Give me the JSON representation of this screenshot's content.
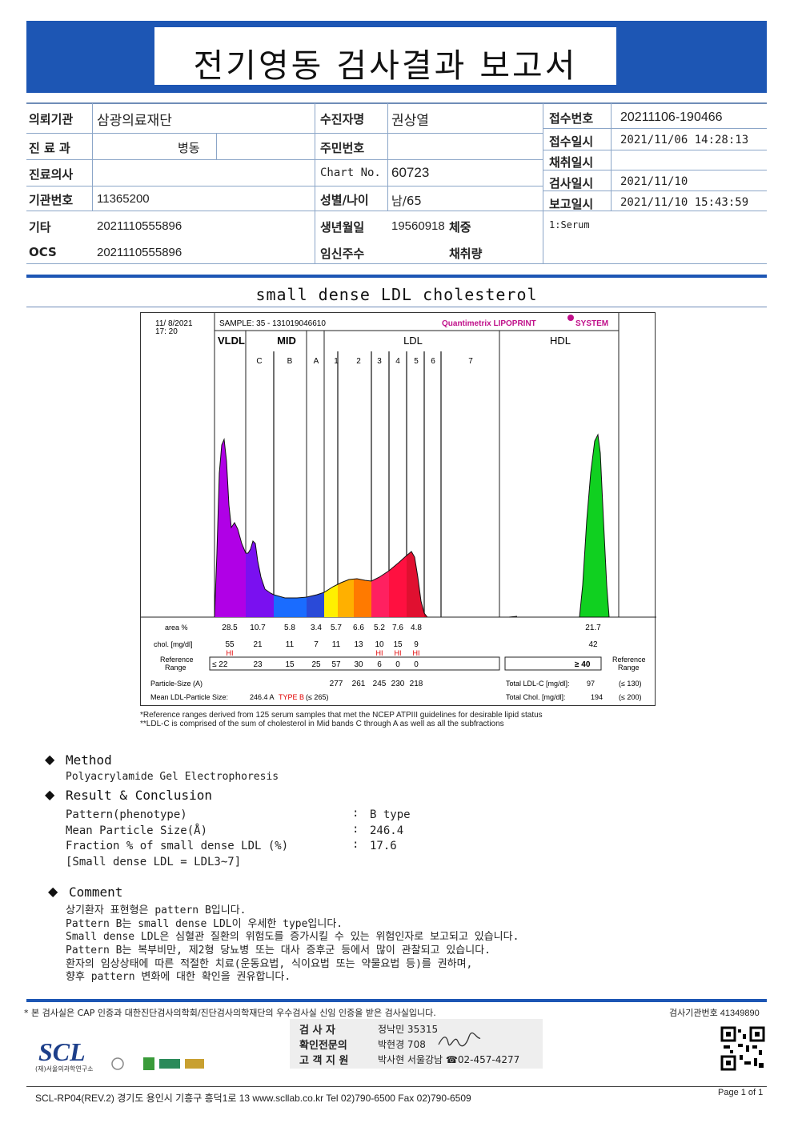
{
  "title": "전기영동 검사결과 보고서",
  "info": {
    "requester_label": "의뢰기관",
    "requester": "삼광의료재단",
    "dept_label": "진 료 과",
    "ward_label": "병동",
    "doctor_label": "진료의사",
    "inst_label": "기관번호",
    "inst": "11365200",
    "etc_label": "기타",
    "etc": "2021110555896",
    "ocs_label": "OCS",
    "ocs": "2021110555896",
    "patient_label": "수진자명",
    "patient": "권상열",
    "rrn_label": "주민번호",
    "chart_label": "Chart No.",
    "chart": "60723",
    "sexage_label": "성별/나이",
    "sexage": "남/65",
    "dob_label": "생년월일",
    "dob": "19560918",
    "weight_label": "체중",
    "preg_label": "임신주수",
    "amount_label": "채취량",
    "recv_no_label": "접수번호",
    "recv_no": "20211106-190466",
    "recv_dt_label": "접수일시",
    "recv_dt": "2021/11/06 14:28:13",
    "collect_label": "채취일시",
    "test_label": "검사일시",
    "test_dt": "2021/11/10",
    "report_label": "보고일시",
    "report_dt": "2021/11/10 15:43:59",
    "specimen": "1:Serum"
  },
  "section_title": "small dense LDL cholesterol",
  "chart_data": {
    "type": "area",
    "header_date": "11/ 8/2021",
    "header_time": "17: 20",
    "sample": "SAMPLE:   35 - 131019046610",
    "brand": "Quantimetrix  LIPOPRINT",
    "brand_system": "SYSTEM",
    "groups": [
      "VLDL",
      "MID",
      "LDL",
      "HDL"
    ],
    "bands": [
      "C",
      "B",
      "A",
      "1",
      "2",
      "3",
      "4",
      "5",
      "6",
      "7"
    ],
    "row_labels": {
      "area": "area %",
      "chol": "chol. [mg/dl]",
      "ref": "Reference Range",
      "ref_right": "Reference Range",
      "particle": "Particle-Size (A)",
      "mean": "Mean LDL-Particle Size:"
    },
    "area": [
      "28.5",
      "10.7",
      "5.8",
      "3.4",
      "5.7",
      "6.6",
      "5.2",
      "7.6",
      "4.8",
      "21.7"
    ],
    "chol": [
      "55",
      "21",
      "11",
      "7",
      "11",
      "13",
      "10",
      "15",
      "9",
      "42"
    ],
    "hi": {
      "vldl": "HI",
      "ldl3": "HI",
      "ldl4": "HI",
      "ldl5": "HI"
    },
    "ref_le": "≤ 22",
    "ref": [
      "23",
      "15",
      "25",
      "57",
      "30",
      "6",
      "0",
      "0"
    ],
    "ref_hdl": "≥  40",
    "particle": [
      "277",
      "261",
      "245",
      "230",
      "218"
    ],
    "mean_size": "246.4  A",
    "mean_type": "TYPE B",
    "mean_ref": "(≤ 265)",
    "total_ldl_label": "Total LDL-C  [mg/dl]:",
    "total_ldl": "97",
    "total_ldl_ref": "(≤ 130)",
    "total_chol_label": "Total Chol.  [mg/dl]:",
    "total_chol": "194",
    "total_chol_ref": "(≤ 200)"
  },
  "notes": [
    "*Reference ranges derived from 125 serum samples that met the NCEP ATPIII guidelines for desirable lipid status",
    "**LDL-C is comprised of the sum of cholesterol in Mid bands C through A as well as all the subfractions"
  ],
  "method": {
    "heading": "Method",
    "text": "Polyacrylamide Gel Electrophoresis"
  },
  "result": {
    "heading": "Result & Conclusion",
    "rows": [
      {
        "label": "Pattern(phenotype)",
        "value": "B type"
      },
      {
        "label": "Mean Particle Size(Å)",
        "value": "246.4"
      },
      {
        "label": "Fraction % of small dense LDL (%)",
        "value": "17.6"
      }
    ],
    "bracket": "[Small dense LDL = LDL3~7]"
  },
  "comment": {
    "heading": "Comment",
    "lines": [
      "상기환자 표현형은 pattern B입니다.",
      "Pattern B는 small dense LDL이 우세한 type입니다.",
      "Small dense LDL은 심혈관 질환의 위험도를 증가시킬 수 있는 위험인자로 보고되고 있습니다.",
      "Pattern B는 복부비만, 제2형 당뇨병 또는 대사 증후군 등에서 많이 관찰되고 있습니다.",
      "환자의 임상상태에 따른 적절한 치료(운동요법, 식이요법 또는 약물요법 등)를 권하며,",
      "향후 pattern 변화에 대한 확인을 권유합니다."
    ]
  },
  "footer": {
    "cert": "* 본 검사실은 CAP 인증과 대한진단검사의학회/진단검사의학재단의 우수검사실 신임 인증을 받은 검사실입니다.",
    "org_no": "검사기관번호 41349890",
    "examiner_label": "검  사  자",
    "examiner": "정낙민 35315",
    "specialist_label": "확인전문의",
    "specialist": "박현경 708",
    "support_label": "고 객 지 원",
    "support": "박사현 서울강남 ☎02-457-4277",
    "logo": "SCL",
    "logo_sub": "(재)서울의과학연구소",
    "form": "SCL-RP04(REV.2)  경기도 용인시 기흥구 흥덕1로 13  www.scllab.co.kr  Tel 02)790-6500  Fax 02)790-6509",
    "page": "Page 1 of 1"
  }
}
